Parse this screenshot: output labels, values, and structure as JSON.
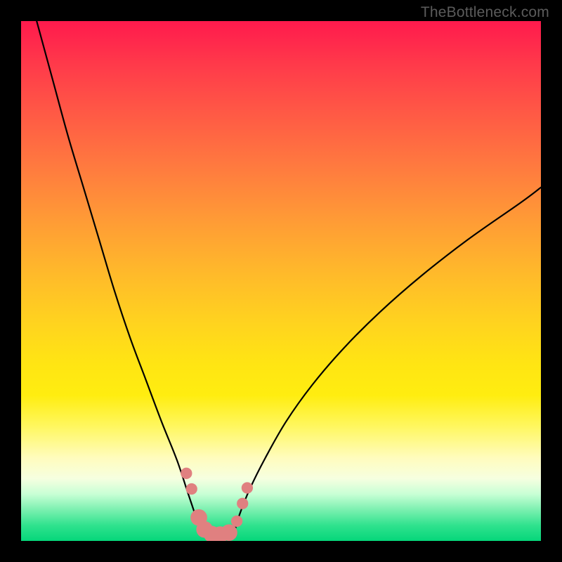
{
  "watermark": "TheBottleneck.com",
  "chart_data": {
    "type": "line",
    "title": "",
    "xlabel": "",
    "ylabel": "",
    "xlim": [
      0,
      100
    ],
    "ylim": [
      0,
      100
    ],
    "legend": false,
    "grid": false,
    "background_gradient": {
      "direction": "vertical",
      "stops": [
        {
          "pos": 0.0,
          "color": "#ff1a4d"
        },
        {
          "pos": 0.5,
          "color": "#ffc525"
        },
        {
          "pos": 0.8,
          "color": "#fffb9a"
        },
        {
          "pos": 0.92,
          "color": "#b0ffc8"
        },
        {
          "pos": 1.0,
          "color": "#05d67a"
        }
      ]
    },
    "series": [
      {
        "name": "left-arm",
        "stroke": "#000000",
        "x": [
          3,
          6,
          9,
          12,
          15,
          18,
          21,
          24,
          27,
          30,
          32,
          33.5,
          34.5
        ],
        "y": [
          100,
          89,
          78,
          68,
          58,
          48,
          39,
          31,
          23,
          15.5,
          9.5,
          5,
          1.5
        ]
      },
      {
        "name": "right-arm",
        "stroke": "#000000",
        "x": [
          41,
          42,
          44,
          47,
          51,
          56,
          62,
          69,
          77,
          86,
          96,
          100
        ],
        "y": [
          1.5,
          5,
          10,
          16,
          23,
          30,
          37,
          44,
          51,
          58,
          65,
          68
        ]
      },
      {
        "name": "valley-floor",
        "stroke": "#000000",
        "x": [
          34.5,
          36,
          38,
          40,
          41
        ],
        "y": [
          1.5,
          0.6,
          0.5,
          0.6,
          1.5
        ]
      }
    ],
    "markers": {
      "name": "valley-markers",
      "color": "#e08080",
      "radius_small": 1.1,
      "radius_large": 1.6,
      "points": [
        {
          "x": 31.8,
          "y": 13.0,
          "r": 1.1
        },
        {
          "x": 32.8,
          "y": 10.0,
          "r": 1.1
        },
        {
          "x": 34.2,
          "y": 4.5,
          "r": 1.6
        },
        {
          "x": 35.3,
          "y": 2.2,
          "r": 1.6
        },
        {
          "x": 36.7,
          "y": 1.3,
          "r": 1.6
        },
        {
          "x": 38.3,
          "y": 1.2,
          "r": 1.6
        },
        {
          "x": 40.0,
          "y": 1.6,
          "r": 1.6
        },
        {
          "x": 41.5,
          "y": 3.8,
          "r": 1.1
        },
        {
          "x": 42.6,
          "y": 7.2,
          "r": 1.1
        },
        {
          "x": 43.5,
          "y": 10.2,
          "r": 1.1
        }
      ]
    }
  }
}
